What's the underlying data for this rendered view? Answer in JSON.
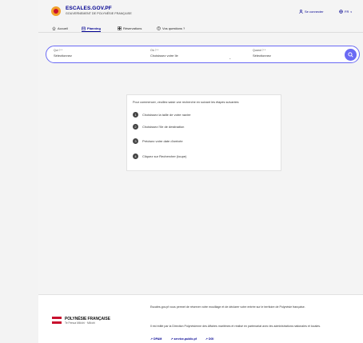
{
  "header": {
    "brand_title": "ESCALES.GOV.PF",
    "brand_subtitle": "GOUVERNEMENT DE POLYNÉSIE FRANÇAISE",
    "login_label": "Se connecter",
    "lang_label": "FR"
  },
  "tabs": [
    {
      "label": "Accueil",
      "icon": "home-icon",
      "active": false
    },
    {
      "label": "Planning",
      "icon": "calendar-icon",
      "active": true
    },
    {
      "label": "Réservations",
      "icon": "grid-icon",
      "active": false
    },
    {
      "label": "Vos questions ?",
      "icon": "help-icon",
      "active": false
    }
  ],
  "search": {
    "who_label": "Qui ? *",
    "who_value": "Sélectionnez",
    "where_label": "Où ? *",
    "where_value": "Choisissez votre île",
    "when_label": "Quand ? *",
    "when_value": "Sélectionnez",
    "colors": {
      "accent": "#6a6af4"
    }
  },
  "card": {
    "intro": "Pour commencer, veuillez saisir une recherche en suivant les étapes suivantes",
    "steps": [
      {
        "num": "1",
        "text": "Choisissez la taille de votre navire"
      },
      {
        "num": "2",
        "text": "Choisissez l'île de destination"
      },
      {
        "num": "3",
        "text": "Précisez votre date d'arrivée"
      },
      {
        "num": "4",
        "text": "Cliquez sur Rechercher (loupe)"
      }
    ]
  },
  "footer": {
    "brand": "POLYNÉSIE FRANÇAISE",
    "brand_sub": "Te Fenua Mā'ohi · Mā'ohi",
    "p1": "Escales.gov.pf vous permet de réserver votre mouillage et de déclarer votre entrée sur le territoire de Polynésie française.",
    "p2": "Il est édité par la Direction Polynésienne des Affaires maritimes et réalisé en partenariat avec les administrations nationales et locales.",
    "links": [
      "DPAM",
      "service-public.pf",
      "DGI"
    ]
  },
  "colors": {
    "brand_blue": "#000091",
    "flag_red": "#c8102e"
  }
}
